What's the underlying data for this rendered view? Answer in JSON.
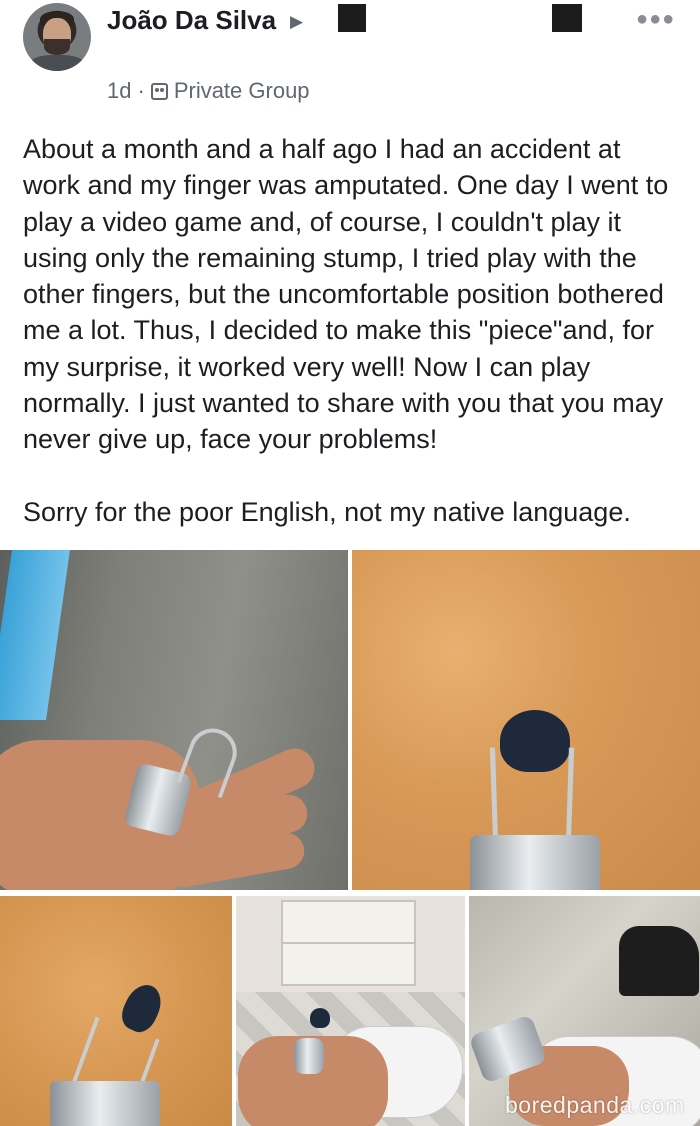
{
  "post": {
    "author": "João Da Silva",
    "time": "1d",
    "separator": "·",
    "audience": "Private Group",
    "paragraphs": [
      "About a month and a half ago I had an accident at work and my finger was amputated. One day I went to play a video game and, of course, I couldn't play it using only the remaining stump, I tried play with the other fingers, but the uncomfortable position bothered me a lot. Thus, I decided to make this \"piece\"and, for my surprise, it worked very well! Now I can play normally. I just wanted to share with you that you may never give up, face your problems!",
      "Sorry for the poor English, not my native language."
    ]
  },
  "icons": {
    "more": "more-options-icon",
    "audience": "private-group-icon",
    "arrow": "caret-right-icon"
  },
  "watermark": "boredpanda.com"
}
